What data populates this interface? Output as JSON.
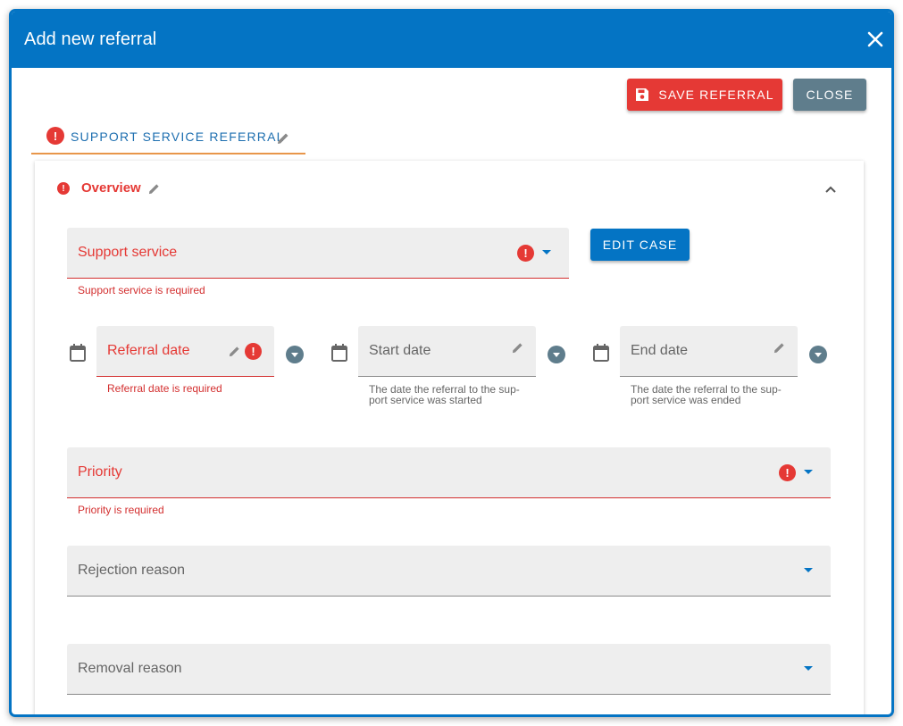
{
  "dialog": {
    "title": "Add new referral",
    "close_icon": "close-icon"
  },
  "toolbar": {
    "save_label": "SAVE REFERRAL",
    "close_label": "CLOSE"
  },
  "tab": {
    "label": "SUPPORT SERVICE REFERRAL"
  },
  "section": {
    "title": "Overview",
    "edit_case_label": "EDIT CASE"
  },
  "fields": {
    "support_service": {
      "label": "Support service",
      "error": "Support service is required"
    },
    "referral_date": {
      "label": "Referral date",
      "error": "Referral date is required"
    },
    "start_date": {
      "label": "Start date",
      "hint": "The date the referral to the sup-port service was started"
    },
    "end_date": {
      "label": "End date",
      "hint": "The date the referral to the sup-port service was ended"
    },
    "priority": {
      "label": "Priority",
      "error": "Priority is required"
    },
    "rejection_reason": {
      "label": "Rejection reason"
    },
    "removal_reason": {
      "label": "Removal reason"
    }
  },
  "colors": {
    "primary": "#0474c4",
    "error": "#e53935",
    "tab_underline": "#e8964a",
    "neutral_button": "#5f7d8c"
  }
}
